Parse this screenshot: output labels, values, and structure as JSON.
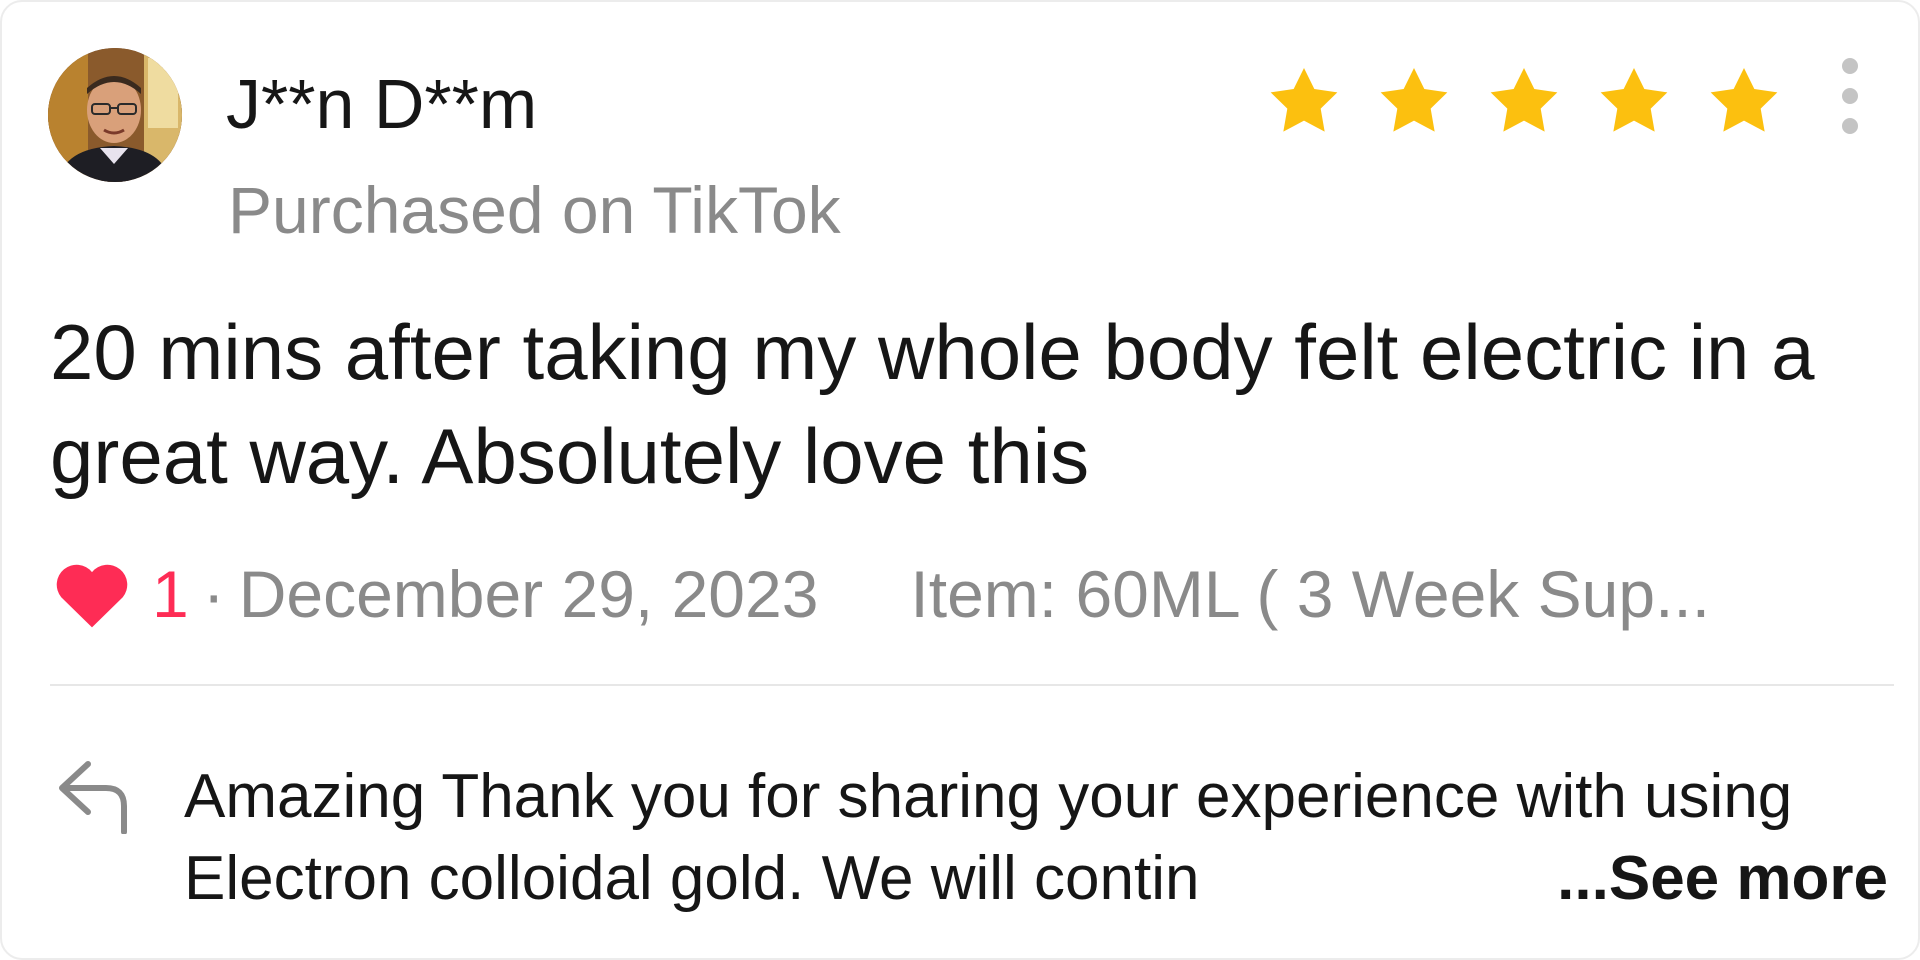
{
  "reviewer": {
    "name": "J**n D**m",
    "purchase_source": "Purchased on TikTok",
    "avatar_icon": "user-photo"
  },
  "rating": {
    "value": 5,
    "max": 5,
    "star_color": "#fcc00f"
  },
  "menu": {
    "icon": "more-vertical-icon"
  },
  "review": {
    "text": "20 mins after taking my whole body felt electric in a great way. Absolutely love this"
  },
  "meta": {
    "like_count": "1",
    "separator": "·",
    "date": "December 29, 2023",
    "item_variant": "Item: 60ML ( 3 Week Sup...",
    "heart_color": "#fe2c55"
  },
  "reply": {
    "text": "Amazing Thank you for sharing your experience with using Electron colloidal gold. We will contin",
    "see_more_label": "...See more",
    "icon": "reply-arrow-icon"
  }
}
